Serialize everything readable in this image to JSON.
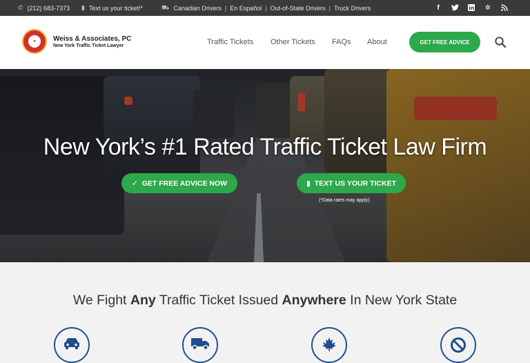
{
  "topbar": {
    "phone": "(212) 683-7373",
    "text_us": "Text us your ticket!*",
    "links": [
      "Canadian Drivers",
      "En Español",
      "Out-of-State Drivers",
      "Truck Drivers"
    ],
    "social_icons": [
      "facebook-icon",
      "twitter-icon",
      "linkedin-icon",
      "yelp-icon",
      "rss-icon"
    ]
  },
  "header": {
    "logo_badge_text": "CALL\nRED\nLIGHT",
    "brand_name": "Weiss & Associates, PC",
    "brand_tagline": "New York Traffic Ticket Lawyer",
    "nav": [
      "Traffic Tickets",
      "Other Tickets",
      "FAQs",
      "About"
    ],
    "cta": "GET FREE ADVICE"
  },
  "hero": {
    "title": "New York’s #1 Rated Traffic Ticket Law Firm",
    "btn_advice": "GET FREE ADVICE NOW",
    "btn_text": "TEXT US YOUR TICKET",
    "note": "(*Data rates may apply)"
  },
  "section": {
    "title_parts": [
      "We Fight ",
      "Any",
      " Traffic Ticket Issued ",
      "Anywhere",
      " In New York State"
    ],
    "feature_icons": [
      "car-icon",
      "truck-icon",
      "maple-leaf-icon",
      "no-entry-icon"
    ]
  },
  "colors": {
    "accent_green": "#2da84a",
    "topbar_bg": "#3a3a3a",
    "icon_blue": "#1f4e8c"
  }
}
